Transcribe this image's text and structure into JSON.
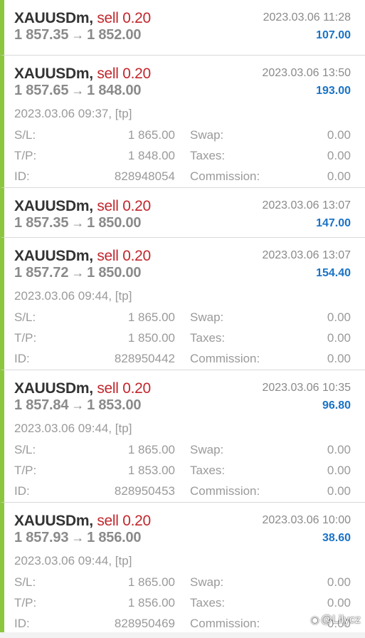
{
  "colors": {
    "accent_bar": "#8cc63f",
    "sell": "#c1272d",
    "profit": "#1a73c6",
    "muted_text": "#8a8a8a"
  },
  "labels": {
    "sl": "S/L:",
    "tp": "T/P:",
    "id": "ID:",
    "swap": "Swap:",
    "taxes": "Taxes:",
    "commission": "Commission:",
    "arrow": "→"
  },
  "trades": [
    {
      "symbol": "XAUUSDm,",
      "action": "sell 0.20",
      "open_price": "1 857.35",
      "close_price": "1 852.00",
      "close_time": "2023.03.06 11:28",
      "profit": "107.00"
    },
    {
      "symbol": "XAUUSDm,",
      "action": "sell 0.20",
      "open_price": "1 857.65",
      "close_price": "1 848.00",
      "close_time": "2023.03.06 13:50",
      "profit": "193.00",
      "open_time": "2023.03.06 09:37, [tp]",
      "sl": "1 865.00",
      "tp": "1 848.00",
      "id": "828948054",
      "swap": "0.00",
      "taxes": "0.00",
      "commission": "0.00"
    },
    {
      "symbol": "XAUUSDm,",
      "action": "sell 0.20",
      "open_price": "1 857.35",
      "close_price": "1 850.00",
      "close_time": "2023.03.06 13:07",
      "profit": "147.00"
    },
    {
      "symbol": "XAUUSDm,",
      "action": "sell 0.20",
      "open_price": "1 857.72",
      "close_price": "1 850.00",
      "close_time": "2023.03.06 13:07",
      "profit": "154.40",
      "open_time": "2023.03.06 09:44, [tp]",
      "sl": "1 865.00",
      "tp": "1 850.00",
      "id": "828950442",
      "swap": "0.00",
      "taxes": "0.00",
      "commission": "0.00"
    },
    {
      "symbol": "XAUUSDm,",
      "action": "sell 0.20",
      "open_price": "1 857.84",
      "close_price": "1 853.00",
      "close_time": "2023.03.06 10:35",
      "profit": "96.80",
      "open_time": "2023.03.06 09:44, [tp]",
      "sl": "1 865.00",
      "tp": "1 853.00",
      "id": "828950453",
      "swap": "0.00",
      "taxes": "0.00",
      "commission": "0.00"
    },
    {
      "symbol": "XAUUSDm,",
      "action": "sell 0.20",
      "open_price": "1 857.93",
      "close_price": "1 856.00",
      "close_time": "2023.03.06 10:00",
      "profit": "38.60",
      "open_time": "2023.03.06 09:44, [tp]",
      "sl": "1 865.00",
      "tp": "1 856.00",
      "id": "828950469",
      "swap": "0.00",
      "taxes": "0.00",
      "commission": "0.00"
    }
  ],
  "watermark": {
    "icon": "weibo-icon",
    "text": "@Lilycz"
  }
}
